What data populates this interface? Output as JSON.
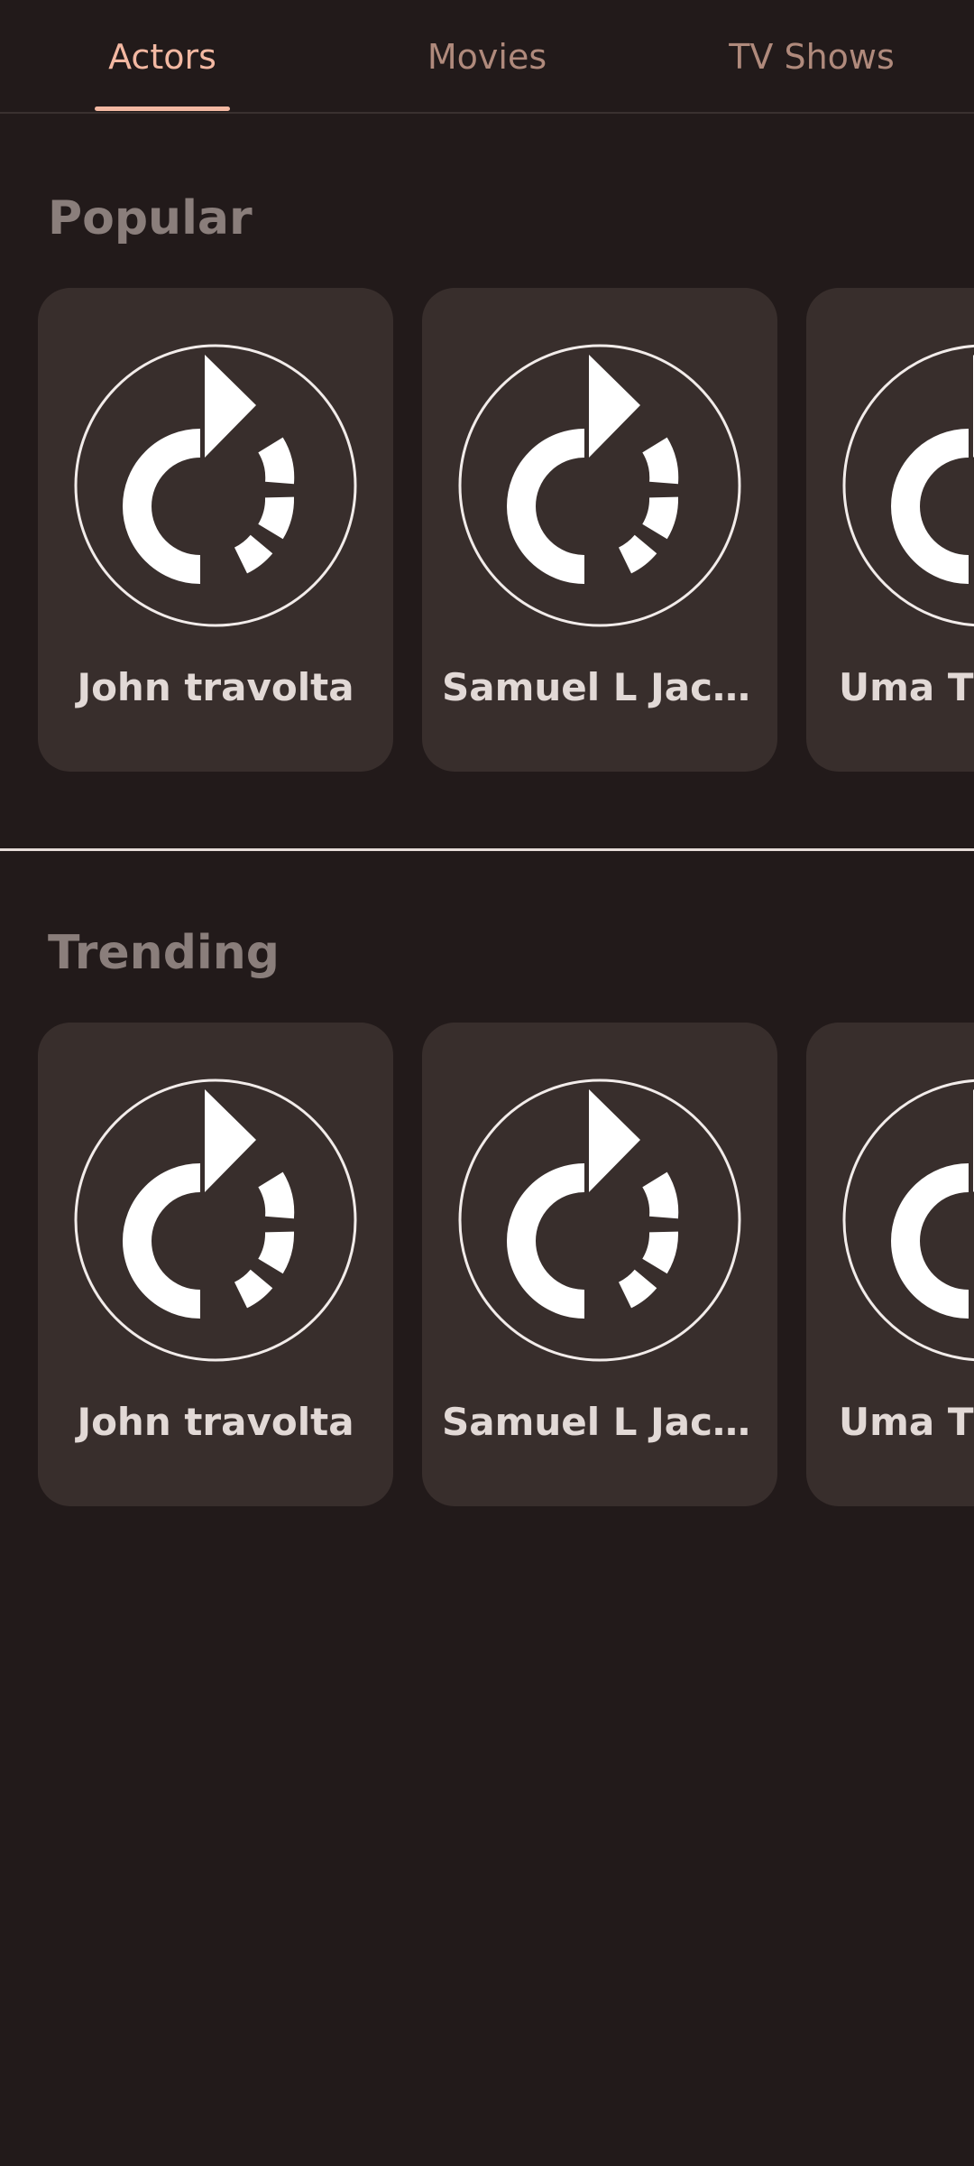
{
  "tabs": [
    {
      "label": "Actors",
      "active": true
    },
    {
      "label": "Movies",
      "active": false
    },
    {
      "label": "TV Shows",
      "active": false
    }
  ],
  "sections": [
    {
      "title": "Popular",
      "cards": [
        {
          "name": "John travolta",
          "icon": "loading-refresh-icon"
        },
        {
          "name": "Samuel L Jack...",
          "icon": "loading-refresh-icon"
        },
        {
          "name": "Uma Th",
          "icon": "loading-refresh-icon"
        }
      ]
    },
    {
      "title": "Trending",
      "cards": [
        {
          "name": "John travolta",
          "icon": "loading-refresh-icon"
        },
        {
          "name": "Samuel L Jack...",
          "icon": "loading-refresh-icon"
        },
        {
          "name": "Uma Th",
          "icon": "loading-refresh-icon"
        }
      ]
    }
  ],
  "colors": {
    "background": "#221a1a",
    "card": "#382e2c",
    "accent": "#f3b8a2",
    "tab_inactive": "#b08a7c",
    "section_title": "#8a7e7b",
    "card_text": "#e2d9d6"
  }
}
